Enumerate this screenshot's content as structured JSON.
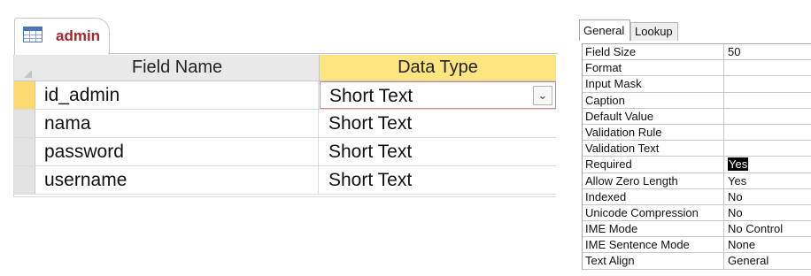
{
  "table_tab": {
    "title": "admin",
    "icon": "table-icon"
  },
  "columns": {
    "field_name": "Field Name",
    "data_type": "Data Type"
  },
  "fields": [
    {
      "name": "id_admin",
      "type": "Short Text"
    },
    {
      "name": "nama",
      "type": "Short Text"
    },
    {
      "name": "password",
      "type": "Short Text"
    },
    {
      "name": "username",
      "type": "Short Text"
    }
  ],
  "dropdown_icon": "chevron-down-icon",
  "property_tabs": {
    "general": "General",
    "lookup": "Lookup"
  },
  "properties": [
    {
      "label": "Field Size",
      "value": "50"
    },
    {
      "label": "Format",
      "value": ""
    },
    {
      "label": "Input Mask",
      "value": ""
    },
    {
      "label": "Caption",
      "value": ""
    },
    {
      "label": "Default Value",
      "value": ""
    },
    {
      "label": "Validation Rule",
      "value": ""
    },
    {
      "label": "Validation Text",
      "value": ""
    },
    {
      "label": "Required",
      "value": "Yes"
    },
    {
      "label": "Allow Zero Length",
      "value": "Yes"
    },
    {
      "label": "Indexed",
      "value": "No"
    },
    {
      "label": "Unicode Compression",
      "value": "No"
    },
    {
      "label": "IME Mode",
      "value": "No Control"
    },
    {
      "label": "IME Sentence Mode",
      "value": "None"
    },
    {
      "label": "Text Align",
      "value": "General"
    }
  ],
  "colors": {
    "tab_title": "#a4262c",
    "active_header": "#ffe57f",
    "current_row_selector": "#fdda6f",
    "active_cell_border": "#e48080"
  }
}
